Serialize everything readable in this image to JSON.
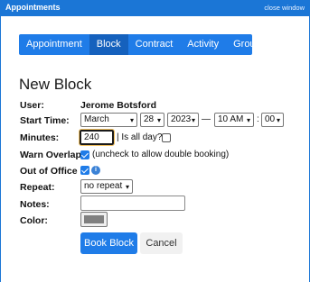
{
  "window": {
    "title": "Appointments",
    "close_label": "close window"
  },
  "tabs": [
    {
      "label": "Appointment",
      "active": false
    },
    {
      "label": "Block",
      "active": true
    },
    {
      "label": "Contract",
      "active": false
    },
    {
      "label": "Activity",
      "active": false
    },
    {
      "label": "Group",
      "active": false
    }
  ],
  "form": {
    "heading": "New Block",
    "user_label": "User:",
    "user_value": "Jerome Botsford",
    "start_time_label": "Start Time:",
    "month": "March",
    "day": "28",
    "year": "2023",
    "dash": "—",
    "hour": "10 AM",
    "colon": ":",
    "minute": "00",
    "minutes_label": "Minutes:",
    "minutes_value": "240",
    "is_all_day_label": "| Is all day?:",
    "is_all_day_checked": false,
    "warn_overlap_label": "Warn Overlap",
    "warn_overlap_checked": true,
    "warn_overlap_hint": "(uncheck to allow double booking)",
    "out_of_office_label": "Out of Office",
    "out_of_office_checked": true,
    "info_glyph": "i",
    "repeat_label": "Repeat:",
    "repeat_value": "no repeat",
    "notes_label": "Notes:",
    "notes_value": "",
    "color_label": "Color:",
    "color_value": "#808080"
  },
  "buttons": {
    "submit_label": "Book Block",
    "cancel_label": "Cancel"
  },
  "colors": {
    "titlebar": "#1b76d6",
    "tab_bar": "#1f7ce8",
    "tab_active": "#1561bd",
    "primary_button": "#1f7ce8"
  }
}
